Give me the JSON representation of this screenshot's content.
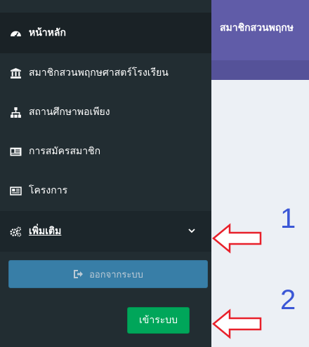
{
  "sidebar": {
    "items": [
      {
        "label": "หน้าหลัก",
        "icon": "dashboard-icon"
      },
      {
        "label": "สมาชิกสวนพฤกษศาสตร์โรงเรียน",
        "icon": "institution-icon"
      },
      {
        "label": "สถานศึกษาพอเพียง",
        "icon": "sitemap-icon"
      },
      {
        "label": "การสมัครสมาชิก",
        "icon": "id-card-icon"
      },
      {
        "label": "โครงการ",
        "icon": "newspaper-icon"
      }
    ],
    "more": {
      "label": "เพิ่มเติม",
      "icon": "cogs-icon"
    },
    "logout_label": "ออกจากระบบ",
    "login_label": "เข้าระบบ"
  },
  "header": {
    "title": "สมาชิกสวนพฤกษ"
  },
  "annotations": {
    "first": "1",
    "second": "2"
  },
  "colors": {
    "sidebar_bg": "#222d32",
    "header_bg": "#605ca8",
    "logout_bg": "#3c8dbc",
    "login_bg": "#00a65a",
    "arrow": "#e8202a",
    "annotation_number": "#3b57d6"
  }
}
